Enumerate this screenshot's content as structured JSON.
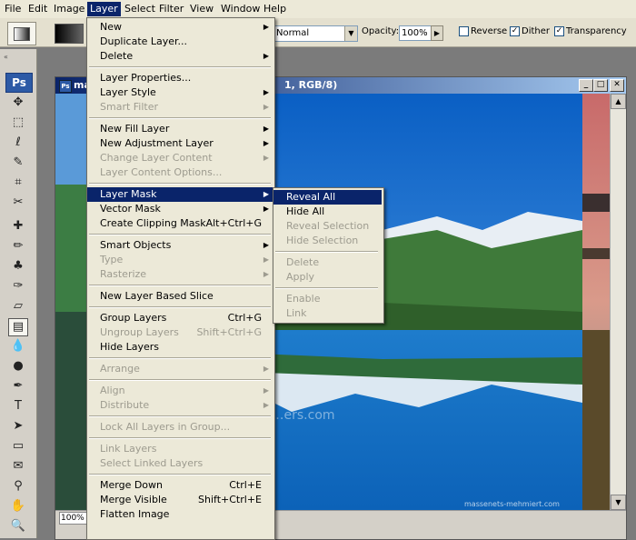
{
  "menubar": {
    "items": [
      {
        "label": "File"
      },
      {
        "label": "Edit"
      },
      {
        "label": "Image"
      },
      {
        "label": "Layer"
      },
      {
        "label": "Select"
      },
      {
        "label": "Filter"
      },
      {
        "label": "View"
      },
      {
        "label": "Window"
      },
      {
        "label": "Help"
      }
    ],
    "active": "Layer"
  },
  "options_bar": {
    "mode_value": "Normal",
    "opacity_label": "Opacity:",
    "opacity_value": "100%",
    "reverse_label": "Reverse",
    "reverse_checked": false,
    "dither_label": "Dither",
    "dither_checked": true,
    "transparency_label": "Transparency",
    "transparency_checked": true
  },
  "toolbox": {
    "logo": "Ps"
  },
  "document": {
    "title_prefix": "ma",
    "title_suffix": "1, RGB/8)",
    "zoom": "100%",
    "watermark_1": "www.…ers.com",
    "watermark_2": "massenets-mehmiert.com"
  },
  "layer_menu": {
    "items": [
      {
        "label": "New",
        "shortcut": "",
        "sub": true,
        "disabled": false
      },
      {
        "label": "Duplicate Layer...",
        "shortcut": "",
        "sub": false,
        "disabled": false
      },
      {
        "label": "Delete",
        "shortcut": "",
        "sub": true,
        "disabled": false
      },
      {
        "sep": true
      },
      {
        "label": "Layer Properties...",
        "shortcut": "",
        "sub": false,
        "disabled": false
      },
      {
        "label": "Layer Style",
        "shortcut": "",
        "sub": true,
        "disabled": false
      },
      {
        "label": "Smart Filter",
        "shortcut": "",
        "sub": true,
        "disabled": true
      },
      {
        "sep": true
      },
      {
        "label": "New Fill Layer",
        "shortcut": "",
        "sub": true,
        "disabled": false
      },
      {
        "label": "New Adjustment Layer",
        "shortcut": "",
        "sub": true,
        "disabled": false
      },
      {
        "label": "Change Layer Content",
        "shortcut": "",
        "sub": true,
        "disabled": true
      },
      {
        "label": "Layer Content Options...",
        "shortcut": "",
        "sub": false,
        "disabled": true
      },
      {
        "sep": true
      },
      {
        "label": "Layer Mask",
        "shortcut": "",
        "sub": true,
        "disabled": false,
        "highlighted": true
      },
      {
        "label": "Vector Mask",
        "shortcut": "",
        "sub": true,
        "disabled": false
      },
      {
        "label": "Create Clipping Mask",
        "shortcut": "Alt+Ctrl+G",
        "sub": false,
        "disabled": false
      },
      {
        "sep": true
      },
      {
        "label": "Smart Objects",
        "shortcut": "",
        "sub": true,
        "disabled": false
      },
      {
        "label": "Type",
        "shortcut": "",
        "sub": true,
        "disabled": true
      },
      {
        "label": "Rasterize",
        "shortcut": "",
        "sub": true,
        "disabled": true
      },
      {
        "sep": true
      },
      {
        "label": "New Layer Based Slice",
        "shortcut": "",
        "sub": false,
        "disabled": false
      },
      {
        "sep": true
      },
      {
        "label": "Group Layers",
        "shortcut": "Ctrl+G",
        "sub": false,
        "disabled": false
      },
      {
        "label": "Ungroup Layers",
        "shortcut": "Shift+Ctrl+G",
        "sub": false,
        "disabled": true
      },
      {
        "label": "Hide Layers",
        "shortcut": "",
        "sub": false,
        "disabled": false
      },
      {
        "sep": true
      },
      {
        "label": "Arrange",
        "shortcut": "",
        "sub": true,
        "disabled": true
      },
      {
        "sep": true
      },
      {
        "label": "Align",
        "shortcut": "",
        "sub": true,
        "disabled": true
      },
      {
        "label": "Distribute",
        "shortcut": "",
        "sub": true,
        "disabled": true
      },
      {
        "sep": true
      },
      {
        "label": "Lock All Layers in Group...",
        "shortcut": "",
        "sub": false,
        "disabled": true
      },
      {
        "sep": true
      },
      {
        "label": "Link Layers",
        "shortcut": "",
        "sub": false,
        "disabled": true
      },
      {
        "label": "Select Linked Layers",
        "shortcut": "",
        "sub": false,
        "disabled": true
      },
      {
        "sep": true
      },
      {
        "label": "Merge Down",
        "shortcut": "Ctrl+E",
        "sub": false,
        "disabled": false
      },
      {
        "label": "Merge Visible",
        "shortcut": "Shift+Ctrl+E",
        "sub": false,
        "disabled": false
      },
      {
        "label": "Flatten Image",
        "shortcut": "",
        "sub": false,
        "disabled": false
      }
    ]
  },
  "mask_submenu": {
    "items": [
      {
        "label": "Reveal All",
        "disabled": false,
        "highlighted": true
      },
      {
        "label": "Hide All",
        "disabled": false
      },
      {
        "label": "Reveal Selection",
        "disabled": true
      },
      {
        "label": "Hide Selection",
        "disabled": true
      },
      {
        "sep": true
      },
      {
        "label": "Delete",
        "disabled": true
      },
      {
        "label": "Apply",
        "disabled": true
      },
      {
        "sep": true
      },
      {
        "label": "Enable",
        "disabled": true
      },
      {
        "label": "Link",
        "disabled": true
      }
    ]
  }
}
